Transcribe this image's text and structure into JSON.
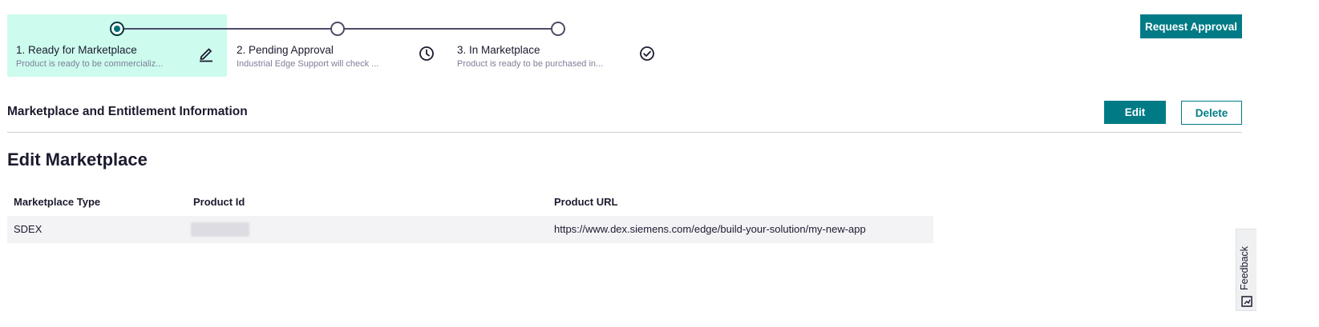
{
  "stepper": {
    "steps": [
      {
        "title": "1. Ready for Marketplace",
        "description": "Product is ready to be commercializ...",
        "icon": "pencil-icon",
        "state": "current"
      },
      {
        "title": "2. Pending Approval",
        "description": "Industrial Edge Support will check ...",
        "icon": "clock-icon",
        "state": "upcoming"
      },
      {
        "title": "3. In Marketplace",
        "description": "Product is ready to be purchased in...",
        "icon": "check-circle-icon",
        "state": "upcoming"
      }
    ]
  },
  "header": {
    "request_approval_label": "Request Approval"
  },
  "section": {
    "title": "Marketplace and Entitlement Information",
    "edit_label": "Edit",
    "delete_label": "Delete"
  },
  "page_title": "Edit Marketplace",
  "table": {
    "columns": [
      "Marketplace Type",
      "Product Id",
      "Product URL"
    ],
    "rows": [
      {
        "marketplace_type": "SDEX",
        "product_id": "",
        "product_url": "https://www.dex.siemens.com/edge/build-your-solution/my-new-app"
      }
    ]
  },
  "feedback": {
    "label": "Feedback",
    "icon": "feedback-icon"
  },
  "colors": {
    "accent": "#007b86",
    "active_step_bg": "#cdfbee",
    "text": "#1b1b2f",
    "muted": "#7d8099"
  }
}
